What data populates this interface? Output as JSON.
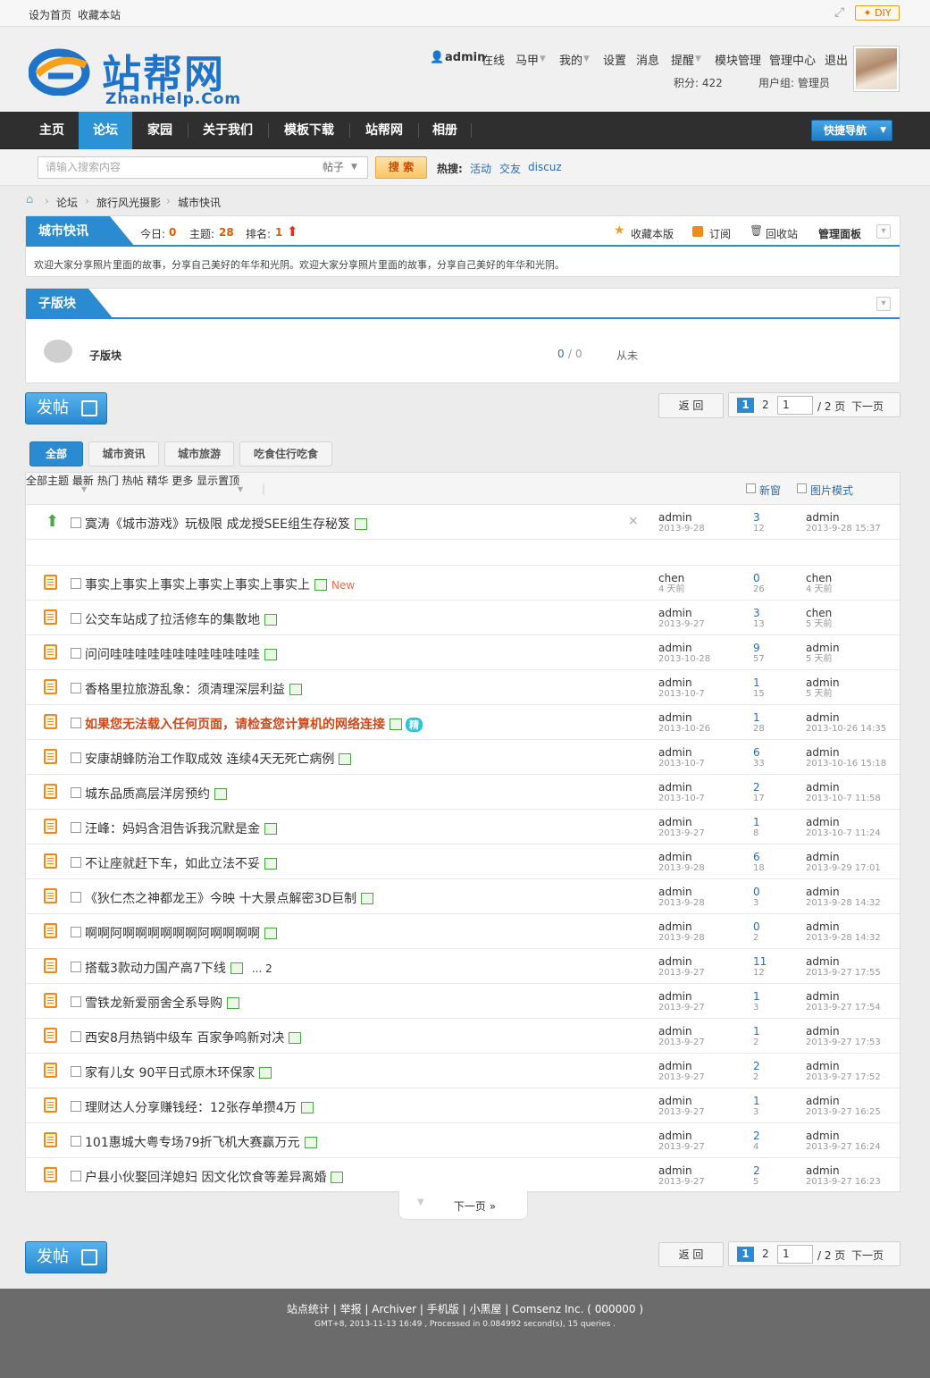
{
  "topbar": {
    "set_home": "设为首页",
    "bookmark": "收藏本站",
    "diy": "DIY"
  },
  "logo": {
    "main": "站帮网",
    "sub": "ZhanHelp.Com"
  },
  "user": {
    "name": "admin",
    "status": "在线",
    "links": [
      "马甲",
      "我的",
      "设置",
      "消息",
      "提醒",
      "模块管理",
      "管理中心",
      "退出"
    ],
    "points": "积分: 422",
    "group": "用户组: 管理员"
  },
  "nav": {
    "items": [
      "主页",
      "论坛",
      "家园",
      "关于我们",
      "模板下载",
      "站帮网",
      "相册"
    ],
    "quick": "快捷导航"
  },
  "search": {
    "placeholder": "请输入搜索内容",
    "type": "帖子",
    "button": "搜 索",
    "hot_label": "热搜:",
    "hot": [
      "活动",
      "交友",
      "discuz"
    ]
  },
  "breadcrumb": [
    "论坛",
    "旅行风光摄影",
    "城市快讯"
  ],
  "forum": {
    "title": "城市快讯",
    "today_label": "今日:",
    "today": "0",
    "topics_label": "主题:",
    "topics": "28",
    "rank_label": "排名:",
    "rank": "1",
    "fav": "收藏本版",
    "rss": "订阅",
    "trash": "回收站",
    "manage": "管理面板",
    "desc": "欢迎大家分享照片里面的故事，分享自己美好的年华和光阴。欢迎大家分享照片里面的故事，分享自己美好的年华和光阴。"
  },
  "subforum": {
    "title": "子版块",
    "name": "子版块",
    "counts_a": "0",
    "counts_sep": " / ",
    "counts_b": "0",
    "last": "从未"
  },
  "actions": {
    "post": "发帖",
    "back": "返 回",
    "page1": "1",
    "page2": "2",
    "input": "1",
    "total": "/ 2 页",
    "next": "下一页"
  },
  "filters": [
    "全部",
    "城市资讯",
    "城市旅游",
    "吃食住行吃食"
  ],
  "listhead": {
    "all": "全部主题",
    "sort": [
      "最新",
      "热门",
      "热帖",
      "精华",
      "更多"
    ],
    "sticky": "显示置顶",
    "newwin": "新窗",
    "picmode": "图片模式"
  },
  "sticky": {
    "title": "寞涛《城市游戏》玩极限 成龙授SEE组生存秘笈",
    "author": "admin",
    "date": "2013-9-28",
    "replies": "3",
    "views": "12",
    "last_user": "admin",
    "last_time": "2013-9-28 15:37"
  },
  "threads": [
    {
      "title": "事实上事实上事实上事实上事实上事实上",
      "new": "New",
      "author": "chen",
      "date": "4 天前",
      "replies": "0",
      "views": "26",
      "last_user": "chen",
      "last_time": "4 天前"
    },
    {
      "title": "公交车站成了拉活修车的集散地",
      "author": "admin",
      "date": "2013-9-27",
      "replies": "3",
      "views": "13",
      "last_user": "chen",
      "last_time": "5 天前"
    },
    {
      "title": "问问哇哇哇哇哇哇哇哇哇哇哇哇",
      "author": "admin",
      "date": "2013-10-28",
      "replies": "9",
      "views": "57",
      "last_user": "admin",
      "last_time": "5 天前"
    },
    {
      "title": "香格里拉旅游乱象：须清理深层利益",
      "author": "admin",
      "date": "2013-10-7",
      "replies": "1",
      "views": "15",
      "last_user": "admin",
      "last_time": "5 天前"
    },
    {
      "title": "如果您无法载入任何页面，请检查您计算机的网络连接",
      "red": true,
      "author": "admin",
      "date": "2013-10-26",
      "replies": "1",
      "views": "28",
      "last_user": "admin",
      "last_time": "2013-10-26 14:35"
    },
    {
      "title": "安康胡蜂防治工作取成效 连续4天无死亡病例",
      "author": "admin",
      "date": "2013-10-7",
      "replies": "6",
      "views": "33",
      "last_user": "admin",
      "last_time": "2013-10-16 15:18"
    },
    {
      "title": "城东品质高层洋房预约",
      "author": "admin",
      "date": "2013-10-7",
      "replies": "2",
      "views": "17",
      "last_user": "admin",
      "last_time": "2013-10-7 11:58"
    },
    {
      "title": "汪峰：妈妈含泪告诉我沉默是金",
      "author": "admin",
      "date": "2013-9-27",
      "replies": "1",
      "views": "8",
      "last_user": "admin",
      "last_time": "2013-10-7 11:24"
    },
    {
      "title": "不让座就赶下车，如此立法不妥",
      "author": "admin",
      "date": "2013-9-28",
      "replies": "6",
      "views": "18",
      "last_user": "admin",
      "last_time": "2013-9-29 17:01"
    },
    {
      "title": "《狄仁杰之神都龙王》今映 十大景点解密3D巨制",
      "author": "admin",
      "date": "2013-9-28",
      "replies": "0",
      "views": "3",
      "last_user": "admin",
      "last_time": "2013-9-28 14:32"
    },
    {
      "title": "啊啊阿啊啊啊啊啊啊阿啊啊啊啊",
      "author": "admin",
      "date": "2013-9-28",
      "replies": "0",
      "views": "2",
      "last_user": "admin",
      "last_time": "2013-9-28 14:32"
    },
    {
      "title": "搭载3款动力国产高7下线",
      "pages": "... 2",
      "author": "admin",
      "date": "2013-9-27",
      "replies": "11",
      "views": "12",
      "last_user": "admin",
      "last_time": "2013-9-27 17:55"
    },
    {
      "title": "雪铁龙新爱丽舍全系导购",
      "author": "admin",
      "date": "2013-9-27",
      "replies": "1",
      "views": "3",
      "last_user": "admin",
      "last_time": "2013-9-27 17:54"
    },
    {
      "title": "西安8月热销中级车 百家争鸣新对决",
      "author": "admin",
      "date": "2013-9-27",
      "replies": "1",
      "views": "2",
      "last_user": "admin",
      "last_time": "2013-9-27 17:53"
    },
    {
      "title": "家有儿女 90平日式原木环保家",
      "author": "admin",
      "date": "2013-9-27",
      "replies": "2",
      "views": "2",
      "last_user": "admin",
      "last_time": "2013-9-27 17:52"
    },
    {
      "title": "理财达人分享赚钱经：12张存单攒4万",
      "author": "admin",
      "date": "2013-9-27",
      "replies": "1",
      "views": "3",
      "last_user": "admin",
      "last_time": "2013-9-27 16:25"
    },
    {
      "title": "101惠城大粤专场79折飞机大赛赢万元",
      "author": "admin",
      "date": "2013-9-27",
      "replies": "2",
      "views": "4",
      "last_user": "admin",
      "last_time": "2013-9-27 16:24"
    },
    {
      "title": "户县小伙娶回洋媳妇 因文化饮食等差异离婚",
      "author": "admin",
      "date": "2013-9-27",
      "replies": "2",
      "views": "5",
      "last_user": "admin",
      "last_time": "2013-9-27 16:23"
    }
  ],
  "nextpage": "下一页 »",
  "footer": {
    "links": "站点统计 | 举报 | Archiver | 手机版 | 小黑屋 | Comsenz Inc. ( 000000 )",
    "info": "GMT+8, 2013-11-13 16:49 , Processed in 0.084992 second(s), 15 queries ."
  }
}
